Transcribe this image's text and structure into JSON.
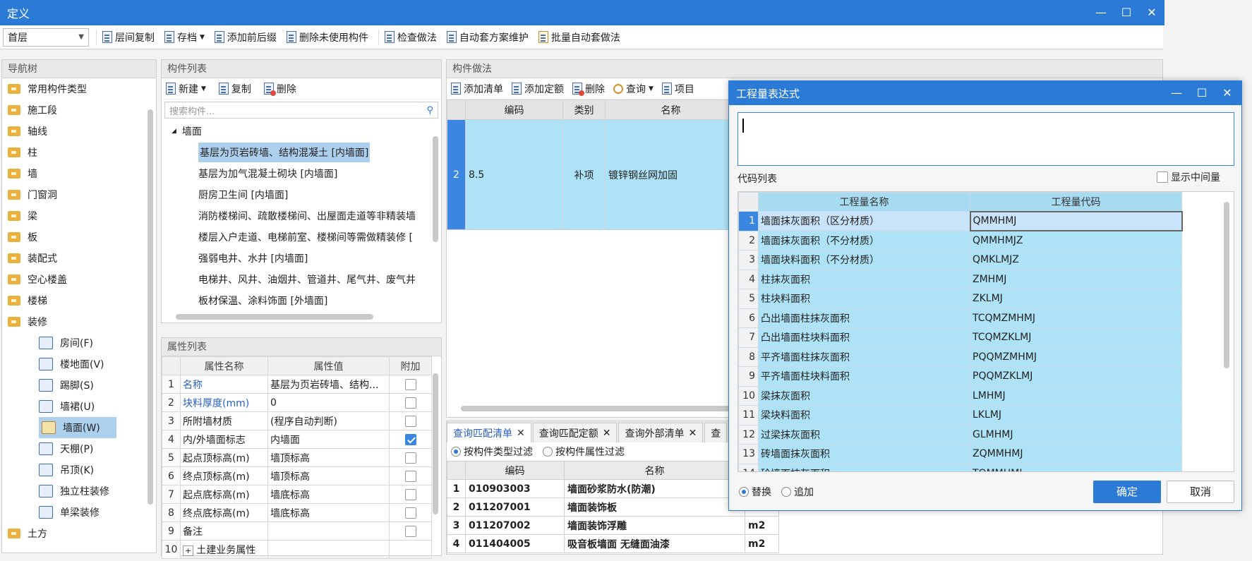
{
  "window": {
    "title": "定义",
    "min": "—",
    "max": "☐",
    "close": "✕"
  },
  "toolbar": {
    "floor": "首层",
    "items": [
      "层间复制",
      "存档",
      "添加前后缀",
      "删除未使用构件",
      "检查做法",
      "自动套方案维护",
      "批量自动套做法"
    ]
  },
  "nav": {
    "title": "导航树",
    "items": [
      "常用构件类型",
      "施工段",
      "轴线",
      "柱",
      "墙",
      "门窗洞",
      "梁",
      "板",
      "装配式",
      "空心楼盖",
      "楼梯",
      "装修"
    ],
    "sub_items": [
      "房间(F)",
      "楼地面(V)",
      "踢脚(S)",
      "墙裙(U)",
      "墙面(W)",
      "天棚(P)",
      "吊顶(K)",
      "独立柱装修",
      "单梁装修"
    ],
    "last": "土方"
  },
  "components": {
    "title": "构件列表",
    "new": "新建",
    "copy": "复制",
    "delete": "删除",
    "search_placeholder": "搜索构件...",
    "root": "墙面",
    "items": [
      "基层为页岩砖墙、结构混凝土 [内墙面]",
      "基层为加气混凝土砌块 [内墙面]",
      "厨房卫生间 [内墙面]",
      "消防楼梯间、疏散楼梯间、出屋面走道等非精装墙",
      "楼层入户走道、电梯前室、楼梯间等需做精装修 [",
      "强弱电井、水井 [内墙面]",
      "电梯井、风井、油烟井、管道井、尾气井、废气井",
      "板材保温、涂料饰面 [外墙面]"
    ]
  },
  "props": {
    "title": "属性列表",
    "headers": [
      "属性名称",
      "属性值",
      "附加"
    ],
    "rows": [
      {
        "n": "1",
        "name": "名称",
        "value": "基层为页岩砖墙、结构..."
      },
      {
        "n": "2",
        "name": "块料厚度(mm)",
        "value": "0"
      },
      {
        "n": "3",
        "name": "所附墙材质",
        "value": "(程序自动判断)"
      },
      {
        "n": "4",
        "name": "内/外墙面标志",
        "value": "内墙面"
      },
      {
        "n": "5",
        "name": "起点顶标高(m)",
        "value": "墙顶标高"
      },
      {
        "n": "6",
        "name": "终点顶标高(m)",
        "value": "墙顶标高"
      },
      {
        "n": "7",
        "name": "起点底标高(m)",
        "value": "墙底标高"
      },
      {
        "n": "8",
        "name": "终点底标高(m)",
        "value": "墙底标高"
      },
      {
        "n": "9",
        "name": "备注",
        "value": ""
      },
      {
        "n": "10",
        "name": "土建业务属性",
        "value": ""
      }
    ]
  },
  "method": {
    "title": "构件做法",
    "tools": [
      "添加清单",
      "添加定额",
      "删除",
      "查询",
      "项目"
    ],
    "headers": [
      "编码",
      "类别",
      "名称"
    ],
    "row": {
      "n": "2",
      "code": "8.5",
      "type": "补项",
      "name": "镀锌钢丝网加固"
    }
  },
  "query": {
    "tabs": [
      "查询匹配清单",
      "查询匹配定额",
      "查询外部清单",
      "查"
    ],
    "filter1": "按构件类型过滤",
    "filter2": "按构件属性过滤",
    "headers": [
      "编码",
      "名称"
    ],
    "rows": [
      {
        "n": "1",
        "code": "010903003",
        "name": "墙面砂浆防水(防潮)",
        "unit": ""
      },
      {
        "n": "2",
        "code": "011207001",
        "name": "墙面装饰板",
        "unit": ""
      },
      {
        "n": "3",
        "code": "011207002",
        "name": "墙面装饰浮雕",
        "unit": "m2"
      },
      {
        "n": "4",
        "code": "011404005",
        "name": "吸音板墙面 无缝面油漆",
        "unit": "m2"
      }
    ]
  },
  "dialog": {
    "title": "工程量表达式",
    "code_list": "代码列表",
    "show_mid": "显示中间量",
    "headers": [
      "工程量名称",
      "工程量代码"
    ],
    "rows": [
      {
        "n": "1",
        "name": "墙面抹灰面积（区分材质）",
        "code": "QMMHMJ"
      },
      {
        "n": "2",
        "name": "墙面抹灰面积（不分材质）",
        "code": "QMMHMJZ"
      },
      {
        "n": "3",
        "name": "墙面块料面积（不分材质）",
        "code": "QMKLMJZ"
      },
      {
        "n": "4",
        "name": "柱抹灰面积",
        "code": "ZMHMJ"
      },
      {
        "n": "5",
        "name": "柱块料面积",
        "code": "ZKLMJ"
      },
      {
        "n": "6",
        "name": "凸出墙面柱抹灰面积",
        "code": "TCQMZMHMJ"
      },
      {
        "n": "7",
        "name": "凸出墙面柱块料面积",
        "code": "TCQMZKLMJ"
      },
      {
        "n": "8",
        "name": "平齐墙面柱抹灰面积",
        "code": "PQQMZMHMJ"
      },
      {
        "n": "9",
        "name": "平齐墙面柱块料面积",
        "code": "PQQMZKLMJ"
      },
      {
        "n": "10",
        "name": "梁抹灰面积",
        "code": "LMHMJ"
      },
      {
        "n": "11",
        "name": "梁块料面积",
        "code": "LKLMJ"
      },
      {
        "n": "12",
        "name": "过梁抹灰面积",
        "code": "GLMHMJ"
      },
      {
        "n": "13",
        "name": "砖墙面抹灰面积",
        "code": "ZQMMHMJ"
      },
      {
        "n": "14",
        "name": "砼墙面抹灰面积",
        "code": "TQMMHMJ"
      }
    ],
    "replace": "替换",
    "append": "追加",
    "ok": "确定",
    "cancel": "取消"
  }
}
